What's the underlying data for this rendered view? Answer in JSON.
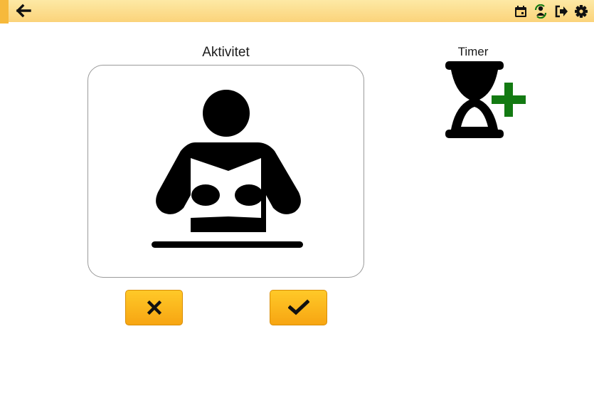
{
  "header": {
    "back_icon": "arrow-left-icon",
    "actions": [
      {
        "icon": "calendar-icon"
      },
      {
        "icon": "user-sync-icon"
      },
      {
        "icon": "sign-out-icon"
      },
      {
        "icon": "gear-icon"
      }
    ],
    "colors": {
      "bar_top": "#fde9a5",
      "bar_bottom": "#fbd37a",
      "accent": "#f6b93b"
    }
  },
  "activity": {
    "title": "Aktivitet",
    "pictogram": "person-reading-icon"
  },
  "timer": {
    "label": "Timer",
    "icon": "hourglass-add-icon",
    "plus_color": "#137a12"
  },
  "buttons": {
    "cancel_icon": "close-icon",
    "confirm_icon": "checkmark-icon",
    "color": "#fbb81d"
  }
}
